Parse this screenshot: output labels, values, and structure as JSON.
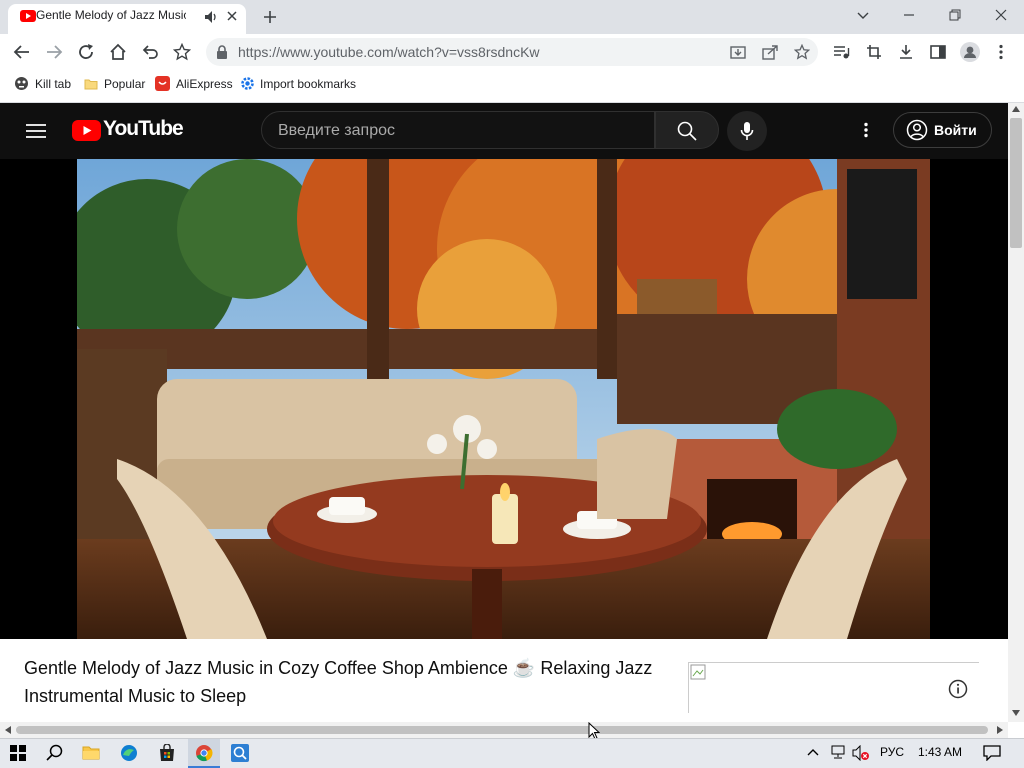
{
  "browser": {
    "tab": {
      "title": "Gentle Melody of Jazz Music in",
      "favicon": "youtube-favicon-icon",
      "audio": "speaker-icon"
    },
    "omnibox": {
      "url": "https://www.youtube.com/watch?v=vss8rsdncKw"
    },
    "bookmarks": [
      {
        "label": "Kill tab",
        "icon": "kill-tab-icon"
      },
      {
        "label": "Popular",
        "icon": "folder-icon"
      },
      {
        "label": "AliExpress",
        "icon": "aliexpress-icon"
      },
      {
        "label": "Import bookmarks",
        "icon": "gear-icon"
      }
    ]
  },
  "youtube": {
    "logo_text": "YouTube",
    "search": {
      "placeholder": "Введите запрос"
    },
    "signin_label": "Войти",
    "video_title": "Gentle Melody of Jazz Music in Cozy Coffee Shop Ambience ☕ Relaxing Jazz Instrumental Music to Sleep",
    "colors": {
      "header": "#0f0f0f",
      "logo_red": "#ff0000"
    }
  },
  "taskbar": {
    "language": "РУС",
    "time": "1:43 AM"
  }
}
